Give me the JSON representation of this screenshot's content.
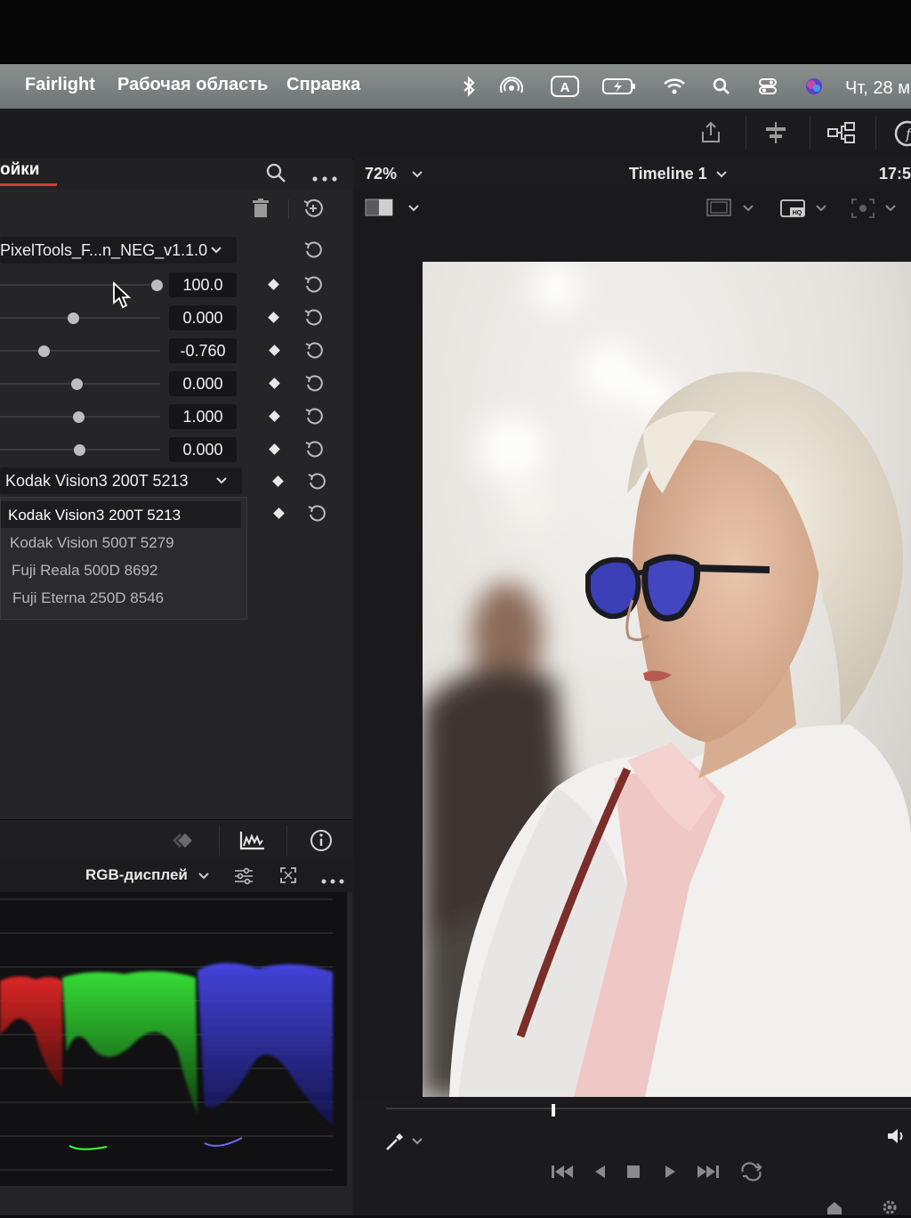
{
  "menubar": {
    "items": [
      "Fairlight",
      "Рабочая область",
      "Справка"
    ],
    "clock": "Чт, 28 м"
  },
  "panel": {
    "tab_label": "ойки",
    "preset_dropdown": "PixelTools_F...n_NEG_v1.1.0",
    "rows": [
      {
        "value": "100.0",
        "level": 1.0
      },
      {
        "value": "0.000",
        "level": 0.46
      },
      {
        "value": "-0.760",
        "level": 0.27
      },
      {
        "value": "0.000",
        "level": 0.47
      },
      {
        "value": "1.000",
        "level": 0.48
      },
      {
        "value": "0.000",
        "level": 0.49
      }
    ],
    "film_dropdown": "Kodak Vision3 200T 5213",
    "film_options": [
      "Kodak Vision3 200T 5213",
      "Kodak Vision 500T 5279",
      "Fuji Reala 500D 8692",
      "Fuji Eterna 250D 8546"
    ]
  },
  "scopes": {
    "mode_label": "RGB-дисплей"
  },
  "viewer": {
    "zoom": "72%",
    "timeline_name": "Timeline 1",
    "timecode": "17:5"
  },
  "icons": {
    "search": "search-icon",
    "more": "more-icon",
    "trash": "trash-icon",
    "reset": "reset-icon",
    "keyframe": "keyframe-diamond-icon"
  },
  "colors": {
    "accent_red": "#d23c3c",
    "panel_bg": "#252528",
    "menubar_bg": "#7d8382"
  }
}
